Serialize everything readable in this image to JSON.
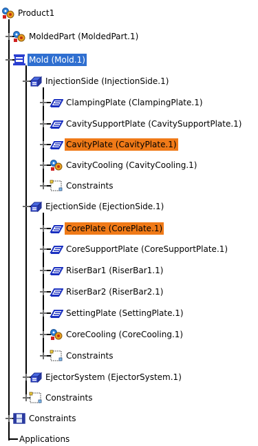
{
  "tree": {
    "nodes": [
      {
        "label": "Product1",
        "icon": "product-gear-icon",
        "level": 0,
        "expander": "none",
        "style": "normal"
      },
      {
        "label": "MoldedPart (MoldedPart.1)",
        "icon": "product-gear-icon",
        "level": 1,
        "expander": "plus",
        "style": "normal"
      },
      {
        "label": "Mold (Mold.1)",
        "icon": "mold-assembly-icon",
        "level": 1,
        "expander": "minus",
        "style": "selected"
      },
      {
        "label": "InjectionSide (InjectionSide.1)",
        "icon": "assembly-icon",
        "level": 2,
        "expander": "minus",
        "style": "normal"
      },
      {
        "label": "ClampingPlate (ClampingPlate.1)",
        "icon": "plate-part-icon",
        "level": 3,
        "expander": "plus",
        "style": "normal"
      },
      {
        "label": "CavitySupportPlate (CavitySupportPlate.1)",
        "icon": "plate-part-icon",
        "level": 3,
        "expander": "plus",
        "style": "normal"
      },
      {
        "label": "CavityPlate (CavityPlate.1)",
        "icon": "plate-part-icon",
        "level": 3,
        "expander": "plus",
        "style": "highlight"
      },
      {
        "label": "CavityCooling (CavityCooling.1)",
        "icon": "product-gear-icon",
        "level": 3,
        "expander": "plus",
        "style": "normal"
      },
      {
        "label": "Constraints",
        "icon": "constraints-icon",
        "level": 3,
        "expander": "plus",
        "style": "normal"
      },
      {
        "label": "EjectionSide (EjectionSide.1)",
        "icon": "assembly-icon",
        "level": 2,
        "expander": "minus",
        "style": "normal"
      },
      {
        "label": "CorePlate (CorePlate.1)",
        "icon": "plate-part-icon",
        "level": 3,
        "expander": "plus",
        "style": "highlight"
      },
      {
        "label": "CoreSupportPlate (CoreSupportPlate.1)",
        "icon": "plate-part-icon",
        "level": 3,
        "expander": "plus",
        "style": "normal"
      },
      {
        "label": "RiserBar1 (RiserBar1.1)",
        "icon": "plate-part-icon",
        "level": 3,
        "expander": "plus",
        "style": "normal"
      },
      {
        "label": "RiserBar2 (RiserBar2.1)",
        "icon": "plate-part-icon",
        "level": 3,
        "expander": "plus",
        "style": "normal"
      },
      {
        "label": "SettingPlate (SettingPlate.1)",
        "icon": "plate-part-icon",
        "level": 3,
        "expander": "plus",
        "style": "normal"
      },
      {
        "label": "CoreCooling (CoreCooling.1)",
        "icon": "product-gear-icon",
        "level": 3,
        "expander": "plus",
        "style": "normal"
      },
      {
        "label": "Constraints",
        "icon": "constraints-icon",
        "level": 3,
        "expander": "plus",
        "style": "normal"
      },
      {
        "label": "EjectorSystem (EjectorSystem.1)",
        "icon": "assembly-icon",
        "level": 2,
        "expander": "plus",
        "style": "normal"
      },
      {
        "label": "Constraints",
        "icon": "constraints-icon",
        "level": 2,
        "expander": "plus",
        "style": "normal"
      },
      {
        "label": "Constraints",
        "icon": "constraints-folder-icon",
        "level": 1,
        "expander": "plus",
        "style": "normal"
      },
      {
        "label": "Applications",
        "icon": "none",
        "level": 1,
        "expander": "none",
        "style": "normal"
      }
    ]
  },
  "colors": {
    "selected_bg": "#2f6fd0",
    "highlight_bg": "#f07a18",
    "tree_line": "#000000",
    "expander": "#6a6a6a"
  }
}
